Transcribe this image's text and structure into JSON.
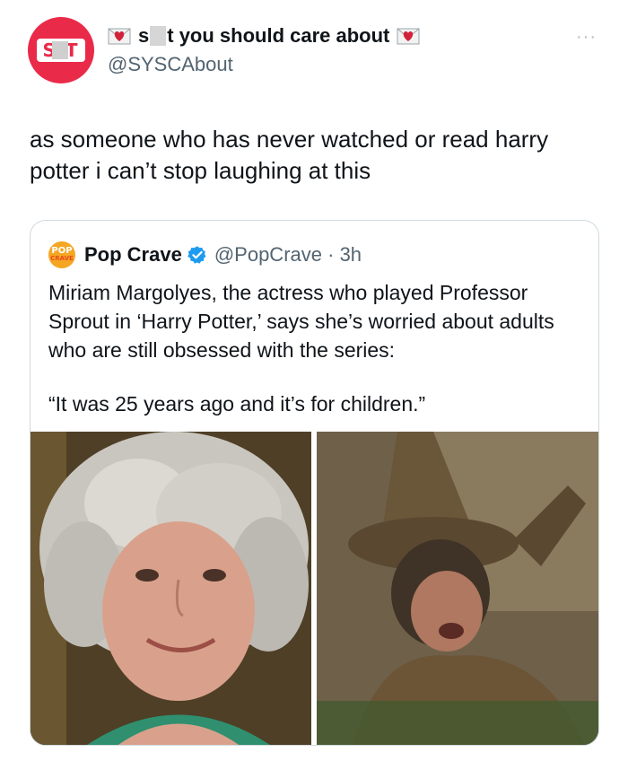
{
  "author": {
    "display_name_start": "s",
    "display_name_end": "t you should care about",
    "handle": "@SYSCAbout",
    "avatar_text": "S T",
    "more_label": "···"
  },
  "tweet": {
    "text": "as someone who has never watched or read harry potter i can’t stop laughing at this"
  },
  "quoted": {
    "logo_top": "POP",
    "logo_bottom": "CRAVE",
    "name": "Pop Crave",
    "handle": "@PopCrave",
    "separator": " · ",
    "time": "3h",
    "text": "Miriam Margolyes, the actress who played Professor Sprout in ‘Harry Potter,’ says she’s worried about adults who are still obsessed with the series:",
    "quote": "“It was 25 years ago and it’s for children.”"
  },
  "colors": {
    "avatar_bg": "#ea2a49",
    "verified": "#1d9bf0",
    "secondary_text": "#536471"
  }
}
